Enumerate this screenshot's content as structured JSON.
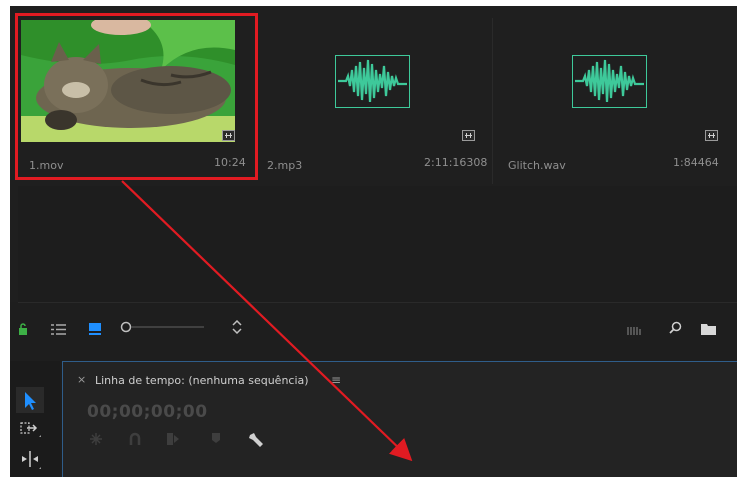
{
  "project_bin": {
    "clips": [
      {
        "name": "1.mov",
        "duration": "10:24",
        "type": "video",
        "badge_icon": "clip-audio-video-icon"
      },
      {
        "name": "2.mp3",
        "duration": "2:11:16308",
        "type": "audio",
        "badge_icon": "clip-audio-video-icon"
      },
      {
        "name": "Glitch.wav",
        "duration": "1:84464",
        "type": "audio",
        "badge_icon": "clip-audio-video-icon"
      }
    ]
  },
  "toolbar": {
    "icons": [
      "lock-icon",
      "list-view-icon",
      "icon-view-icon",
      "zoom-slider",
      "sort-icon",
      "automate-to-sequence-icon",
      "search-icon",
      "new-bin-icon"
    ]
  },
  "timeline": {
    "close_label": "×",
    "title": "Linha de tempo: (nenhuma sequência)",
    "menu_icon": "≡",
    "timecode": "00;00;00;00"
  },
  "tools": [
    "selection-tool-icon",
    "track-select-tool-icon",
    "ripple-edit-tool-icon"
  ],
  "colors": {
    "accent": "#1f8fff",
    "audio_waveform": "#3ec99a",
    "highlight": "#e11b22",
    "lock_green": "#3db046"
  }
}
